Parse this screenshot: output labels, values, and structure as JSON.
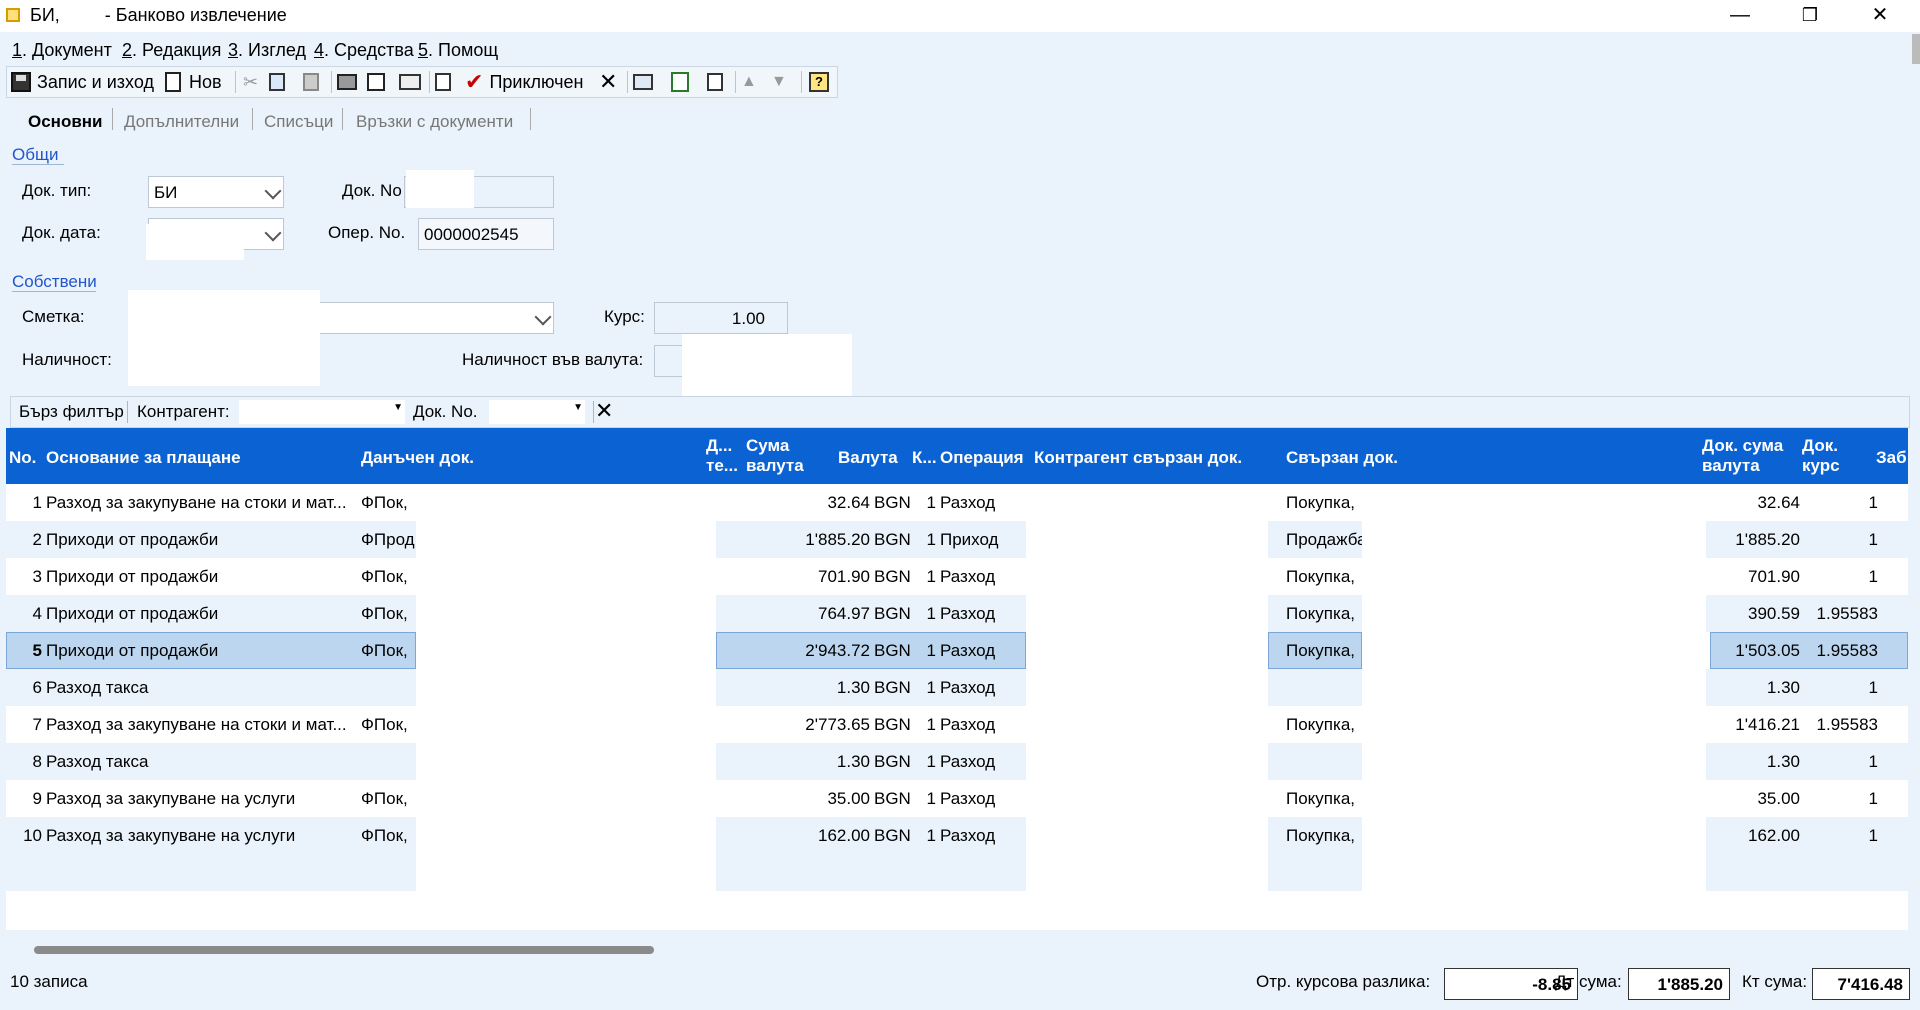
{
  "window": {
    "title_prefix": "БИ,",
    "title_suffix": "- Банково извлечение",
    "minimize": "—",
    "maximize": "❐",
    "close": "✕"
  },
  "menu": [
    {
      "key": "1",
      "label": ". Документ"
    },
    {
      "key": "2",
      "label": ". Редакция"
    },
    {
      "key": "3",
      "label": ". Изглед"
    },
    {
      "key": "4",
      "label": ". Средства"
    },
    {
      "key": "5",
      "label": ". Помощ"
    }
  ],
  "toolbar": {
    "save_exit": "Запис и изход",
    "new": "Нов",
    "finished": "Приключен"
  },
  "tabs": [
    "Основни",
    "Допълнителни",
    "Списъци",
    "Връзки с документи"
  ],
  "general": {
    "section": "Общи",
    "doc_type_label": "Док. тип:",
    "doc_type_value": "БИ",
    "doc_no_label": "Док. No",
    "doc_date_label": "Док. дата:",
    "oper_no_label": "Опер. No.",
    "oper_no_value": "0000002545"
  },
  "own": {
    "section": "Собствени",
    "account_label": "Сметка:",
    "rate_label": "Курс:",
    "rate_value": "1.00",
    "availability_label": "Наличност:",
    "availability_fx_label": "Наличност във валута:"
  },
  "filter": {
    "quick": "Бърз филтър",
    "counterparty_label": "Контрагент:",
    "doc_no_label": "Док. No."
  },
  "grid": {
    "headers": {
      "no": "No.",
      "basis": "Основание за плащане",
      "tax_doc": "Данъчен док.",
      "d_line1": "Д...",
      "d_line2": "те...",
      "amount_line1": "Сума",
      "amount_line2": "валута",
      "currency": "Валута",
      "k": "К...",
      "operation": "Операция",
      "cp_doc": "Контрагент свързан док.",
      "linked_doc": "Свързан док.",
      "doc_amount_line1": "Док. сума",
      "doc_amount_line2": "валута",
      "doc_rate_line1": "Док.",
      "doc_rate_line2": "курс",
      "extra": "Заб"
    },
    "rows": [
      {
        "no": "1",
        "basis": "Разход за закупуване на стоки и мат...",
        "tax_doc": "ФПок,",
        "amount": "32.64",
        "currency": "BGN",
        "k": "1",
        "operation": "Разход",
        "cp": "",
        "linked": "Покупка,",
        "doc_amount": "32.64",
        "doc_rate": "1"
      },
      {
        "no": "2",
        "basis": "Приходи от продажби",
        "tax_doc": "ФПрод,",
        "amount": "1'885.20",
        "currency": "BGN",
        "k": "1",
        "operation": "Приход",
        "cp": "",
        "linked": "Продажба,",
        "doc_amount": "1'885.20",
        "doc_rate": "1"
      },
      {
        "no": "3",
        "basis": "Приходи от продажби",
        "tax_doc": "ФПок,",
        "amount": "701.90",
        "currency": "BGN",
        "k": "1",
        "operation": "Разход",
        "cp": "",
        "linked": "Покупка,",
        "doc_amount": "701.90",
        "doc_rate": "1"
      },
      {
        "no": "4",
        "basis": "Приходи от продажби",
        "tax_doc": "ФПок,",
        "amount": "764.97",
        "currency": "BGN",
        "k": "1",
        "operation": "Разход",
        "cp": "",
        "linked": "Покупка,",
        "doc_amount": "390.59",
        "doc_rate": "1.95583"
      },
      {
        "no": "5",
        "basis": "Приходи от продажби",
        "tax_doc": "ФПок,",
        "amount": "2'943.72",
        "currency": "BGN",
        "k": "1",
        "operation": "Разход",
        "cp": "",
        "linked": "Покупка,",
        "doc_amount": "1'503.05",
        "doc_rate": "1.95583"
      },
      {
        "no": "6",
        "basis": "Разход такса",
        "tax_doc": "",
        "amount": "1.30",
        "currency": "BGN",
        "k": "1",
        "operation": "Разход",
        "cp": "",
        "linked": "",
        "doc_amount": "1.30",
        "doc_rate": "1"
      },
      {
        "no": "7",
        "basis": "Разход за закупуване на стоки и мат...",
        "tax_doc": "ФПок,",
        "amount": "2'773.65",
        "currency": "BGN",
        "k": "1",
        "operation": "Разход",
        "cp": "...",
        "linked": "Покупка,",
        "doc_amount": "1'416.21",
        "doc_rate": "1.95583"
      },
      {
        "no": "8",
        "basis": "Разход такса",
        "tax_doc": "",
        "amount": "1.30",
        "currency": "BGN",
        "k": "1",
        "operation": "Разход",
        "cp": "",
        "linked": "",
        "doc_amount": "1.30",
        "doc_rate": "1"
      },
      {
        "no": "9",
        "basis": "Разход за закупуване на услуги",
        "tax_doc": "ФПок,",
        "amount": "35.00",
        "currency": "BGN",
        "k": "1",
        "operation": "Разход",
        "cp": "",
        "linked": "Покупка,",
        "doc_amount": "35.00",
        "doc_rate": "1"
      },
      {
        "no": "10",
        "basis": "Разход за закупуване на услуги",
        "tax_doc": "ФПок,",
        "amount": "162.00",
        "currency": "BGN",
        "k": "1",
        "operation": "Разход",
        "cp": "",
        "linked": "Покупка,",
        "doc_amount": "162.00",
        "doc_rate": "1"
      }
    ],
    "selected_row": 4
  },
  "status": {
    "records": "10 записа",
    "fx_diff_label": "Отр. курсова разлика:",
    "fx_diff_value": "-8.85",
    "dt_label": "Дт сума:",
    "dt_value": "1'885.20",
    "kt_label": "Кт сума:",
    "kt_value": "7'416.48"
  }
}
